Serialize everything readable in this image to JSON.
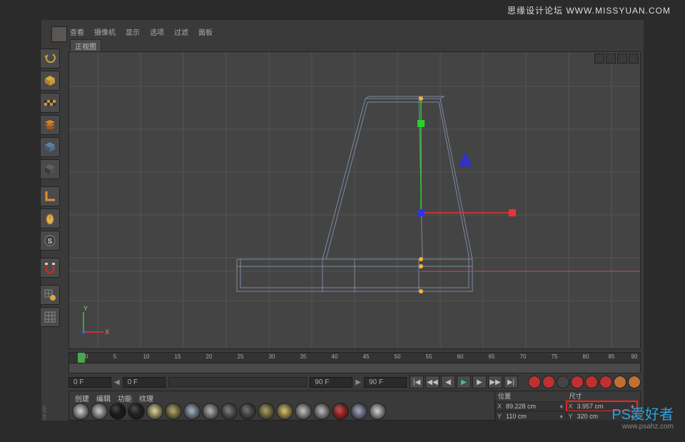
{
  "watermark": {
    "top": "思缘设计论坛  WWW.MISSYUAN.COM",
    "br_main": "PS爱好者",
    "br_sub": "www.psahz.com"
  },
  "app_icon": "cinema4d-icon",
  "menu": [
    "查看",
    "摄像机",
    "显示",
    "选项",
    "过滤",
    "面板"
  ],
  "view_label": "正视图",
  "tools": [
    {
      "name": "undo-icon"
    },
    {
      "name": "cube-yellow-icon"
    },
    {
      "name": "checker-icon"
    },
    {
      "name": "layers-icon"
    },
    {
      "name": "cube-blue-icon"
    },
    {
      "name": "cube-dark-icon"
    },
    {
      "name": "sep"
    },
    {
      "name": "lshape-icon"
    },
    {
      "name": "mouse-icon"
    },
    {
      "name": "sphere-s-icon"
    },
    {
      "name": "sep"
    },
    {
      "name": "magnet-icon"
    },
    {
      "name": "sep"
    },
    {
      "name": "grid-lock-icon"
    },
    {
      "name": "grid-icon"
    }
  ],
  "timeline": {
    "ticks": [
      0,
      5,
      10,
      15,
      20,
      25,
      30,
      35,
      40,
      45,
      50,
      55,
      60,
      65,
      70,
      75,
      80,
      85,
      90
    ],
    "start_field": "0 F",
    "playhead_field": "0 F",
    "end_field": "90 F",
    "end_field2": "90 F"
  },
  "transport_icons": {
    "first": "|◀",
    "prev": "◀◀",
    "back": "◀",
    "play": "▶",
    "fwd": "▶",
    "next": "▶▶",
    "last": "▶|"
  },
  "bottom_tabs": [
    "创建",
    "编辑",
    "功能",
    "纹理"
  ],
  "materials": [
    "#d0d0d0",
    "#c8c8c8",
    "#202020",
    "#2a2a2a",
    "#e0d090",
    "#b0a060",
    "#a0b0c0",
    "#b0b0b0",
    "#707070",
    "#606060",
    "#a89858",
    "#d8c060",
    "#c0c0c0",
    "#b8b8b8",
    "#d03030",
    "#a0a0c0",
    "#d0d0d0"
  ],
  "coords": {
    "pos_label": "位置",
    "size_label": "尺寸",
    "x_label": "X",
    "y_label": "Y",
    "pos_x": "89.228 cm",
    "pos_y": "110 cm",
    "size_x": "3.957 cm",
    "size_y": "320 cm"
  },
  "axes": {
    "y": "Y",
    "x": "X"
  },
  "logo_left": "MA 4D"
}
